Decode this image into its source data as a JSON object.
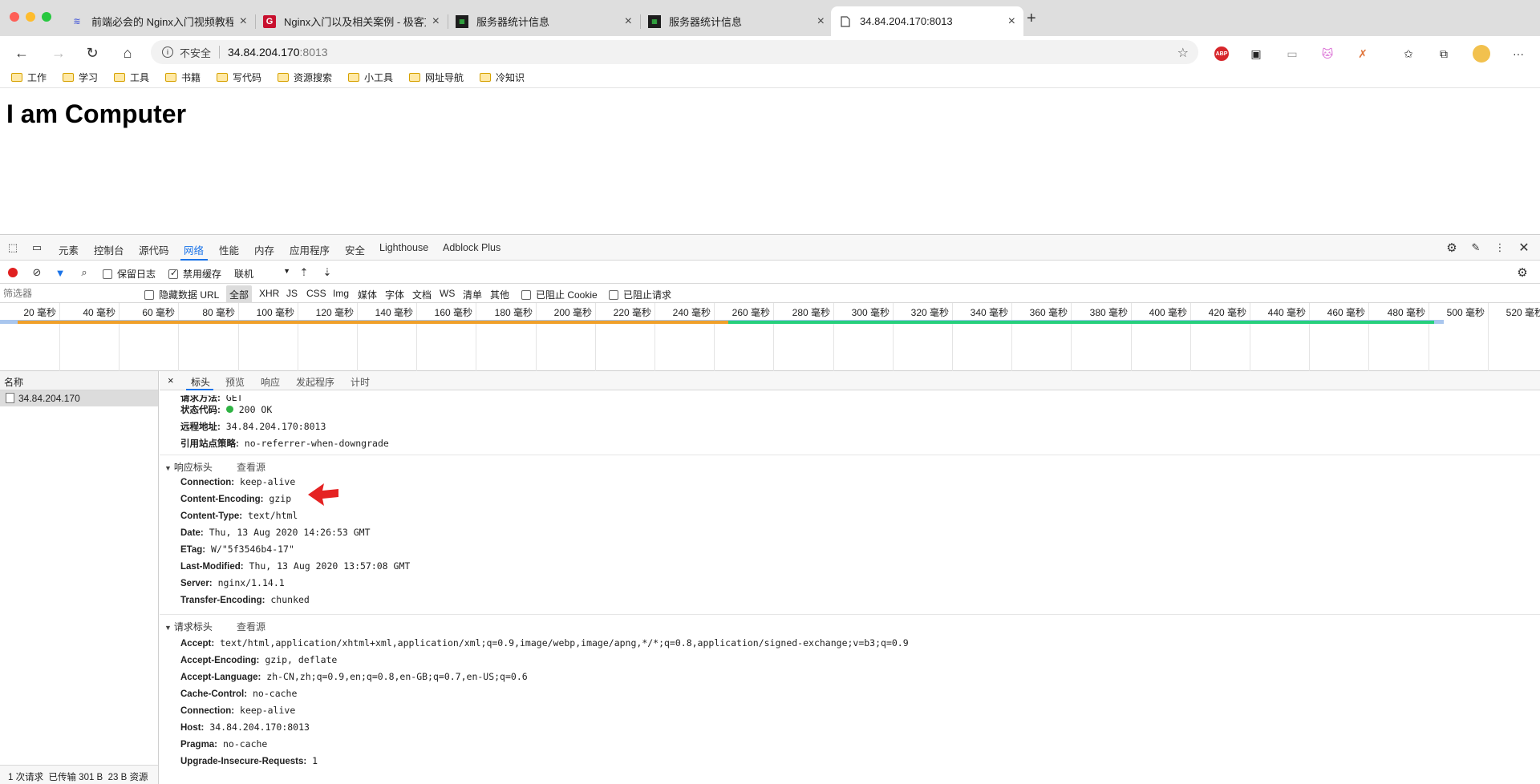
{
  "tabs": [
    {
      "title": "前端必会的 Nginx入门视频教程（",
      "favicon": "layers-icon"
    },
    {
      "title": "Nginx入门以及相关案例 - 极客文",
      "favicon": "g-logo-icon"
    },
    {
      "title": "服务器统计信息",
      "favicon": "terminal-icon"
    },
    {
      "title": "服务器统计信息",
      "favicon": "terminal-icon"
    },
    {
      "title": "34.84.204.170:8013",
      "favicon": "page-icon"
    }
  ],
  "address": {
    "security": "不安全",
    "host": "34.84.204.170",
    "port": ":8013"
  },
  "bookmarks": [
    "工作",
    "学习",
    "工具",
    "书籍",
    "写代码",
    "资源搜索",
    "小工具",
    "网址导航",
    "冷知识"
  ],
  "page": {
    "heading": "I am Computer"
  },
  "devtools": {
    "tabs": [
      "元素",
      "控制台",
      "源代码",
      "网络",
      "性能",
      "内存",
      "应用程序",
      "安全",
      "Lighthouse",
      "Adblock Plus"
    ],
    "network_toolbar": {
      "preserve_log": "保留日志",
      "disable_cache": "禁用缓存",
      "throttle": "联机"
    },
    "filter": {
      "placeholder": "筛选器",
      "hide_data_urls": "隐藏数据 URL",
      "types": [
        "全部",
        "XHR",
        "JS",
        "CSS",
        "Img",
        "媒体",
        "字体",
        "文档",
        "WS",
        "清单",
        "其他"
      ],
      "blocked_cookies": "已阻止 Cookie",
      "blocked_requests": "已阻止请求"
    },
    "timeline_ticks": [
      "20 毫秒",
      "40 毫秒",
      "60 毫秒",
      "80 毫秒",
      "100 毫秒",
      "120 毫秒",
      "140 毫秒",
      "160 毫秒",
      "180 毫秒",
      "200 毫秒",
      "220 毫秒",
      "240 毫秒",
      "260 毫秒",
      "280 毫秒",
      "300 毫秒",
      "320 毫秒",
      "340 毫秒",
      "360 毫秒",
      "380 毫秒",
      "400 毫秒",
      "420 毫秒",
      "440 毫秒",
      "460 毫秒",
      "480 毫秒",
      "500 毫秒",
      "520 毫秒"
    ],
    "name_column": "名称",
    "request_name": "34.84.204.170",
    "status_bar": "1 次请求  已传输 301 B  23 B 资源",
    "detail_tabs": [
      "标头",
      "预览",
      "响应",
      "发起程序",
      "计时"
    ],
    "general": [
      {
        "key": "请求方法:",
        "value": "GET"
      },
      {
        "key": "状态代码:",
        "value": "200 OK"
      },
      {
        "key": "远程地址:",
        "value": "34.84.204.170:8013"
      },
      {
        "key": "引用站点策略:",
        "value": "no-referrer-when-downgrade"
      }
    ],
    "response_headers_title": "响应标头",
    "view_source": "查看源",
    "response_headers": [
      {
        "key": "Connection:",
        "value": "keep-alive"
      },
      {
        "key": "Content-Encoding:",
        "value": "gzip"
      },
      {
        "key": "Content-Type:",
        "value": "text/html"
      },
      {
        "key": "Date:",
        "value": "Thu, 13 Aug 2020 14:26:53 GMT"
      },
      {
        "key": "ETag:",
        "value": "W/\"5f3546b4-17\""
      },
      {
        "key": "Last-Modified:",
        "value": "Thu, 13 Aug 2020 13:57:08 GMT"
      },
      {
        "key": "Server:",
        "value": "nginx/1.14.1"
      },
      {
        "key": "Transfer-Encoding:",
        "value": "chunked"
      }
    ],
    "request_headers_title": "请求标头",
    "request_headers": [
      {
        "key": "Accept:",
        "value": "text/html,application/xhtml+xml,application/xml;q=0.9,image/webp,image/apng,*/*;q=0.8,application/signed-exchange;v=b3;q=0.9"
      },
      {
        "key": "Accept-Encoding:",
        "value": "gzip, deflate"
      },
      {
        "key": "Accept-Language:",
        "value": "zh-CN,zh;q=0.9,en;q=0.8,en-GB;q=0.7,en-US;q=0.6"
      },
      {
        "key": "Cache-Control:",
        "value": "no-cache"
      },
      {
        "key": "Connection:",
        "value": "keep-alive"
      },
      {
        "key": "Host:",
        "value": "34.84.204.170:8013"
      },
      {
        "key": "Pragma:",
        "value": "no-cache"
      },
      {
        "key": "Upgrade-Insecure-Requests:",
        "value": "1"
      }
    ]
  },
  "colors": {
    "accent": "#1a73e8",
    "waiting": "#f0a02a",
    "download": "#26d07c",
    "status_ok": "#2fb344",
    "arrow": "#e52222",
    "record": "#e02020"
  }
}
